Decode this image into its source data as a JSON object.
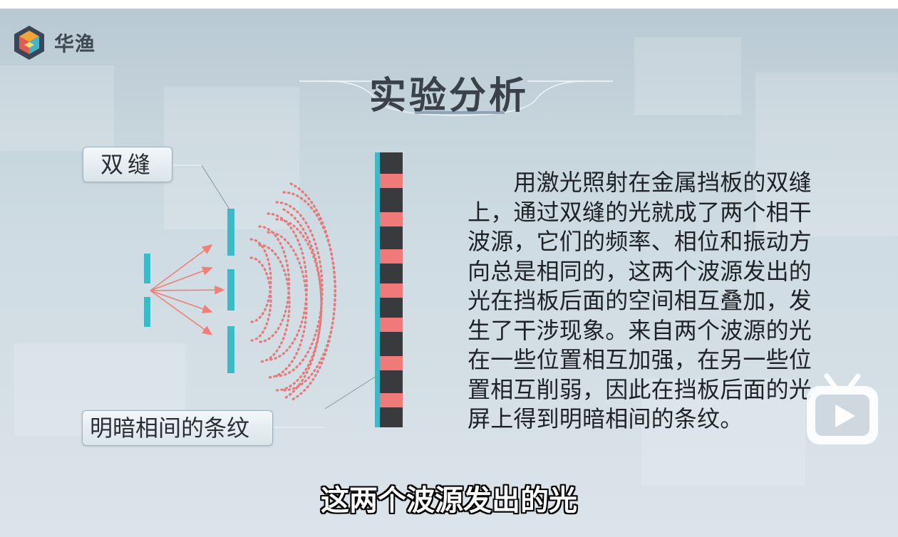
{
  "brand": {
    "name": "华渔"
  },
  "slide": {
    "title": "实验分析",
    "label_double_slit": "双缝",
    "label_fringes": "明暗相间的条纹",
    "paragraph_lines": [
      "　　用激光照射在金属挡板的双缝",
      "上，通过双缝的光就成了两个相干",
      "波源，它们的频率、相位和振动方",
      "向总是相同的，这两个波源发出的",
      "光在挡板后面的空间相互叠加，发",
      "生了干涉现象。来自两个波源的光",
      "在一些位置相互加强，在另一些位",
      "置相互削弱，因此在挡板后面的光",
      "屏上得到明暗相间的条纹。"
    ]
  },
  "subtitle": "这两个波源发出的光",
  "player": {
    "play_icon": "play-icon"
  },
  "colors": {
    "slit": "#3cbac9",
    "arrow": "#f08076",
    "wave": "#e86a6a",
    "fringe_bright": "#f07a7a",
    "fringe_dark": "#383a3d",
    "title": "#3a4148"
  }
}
